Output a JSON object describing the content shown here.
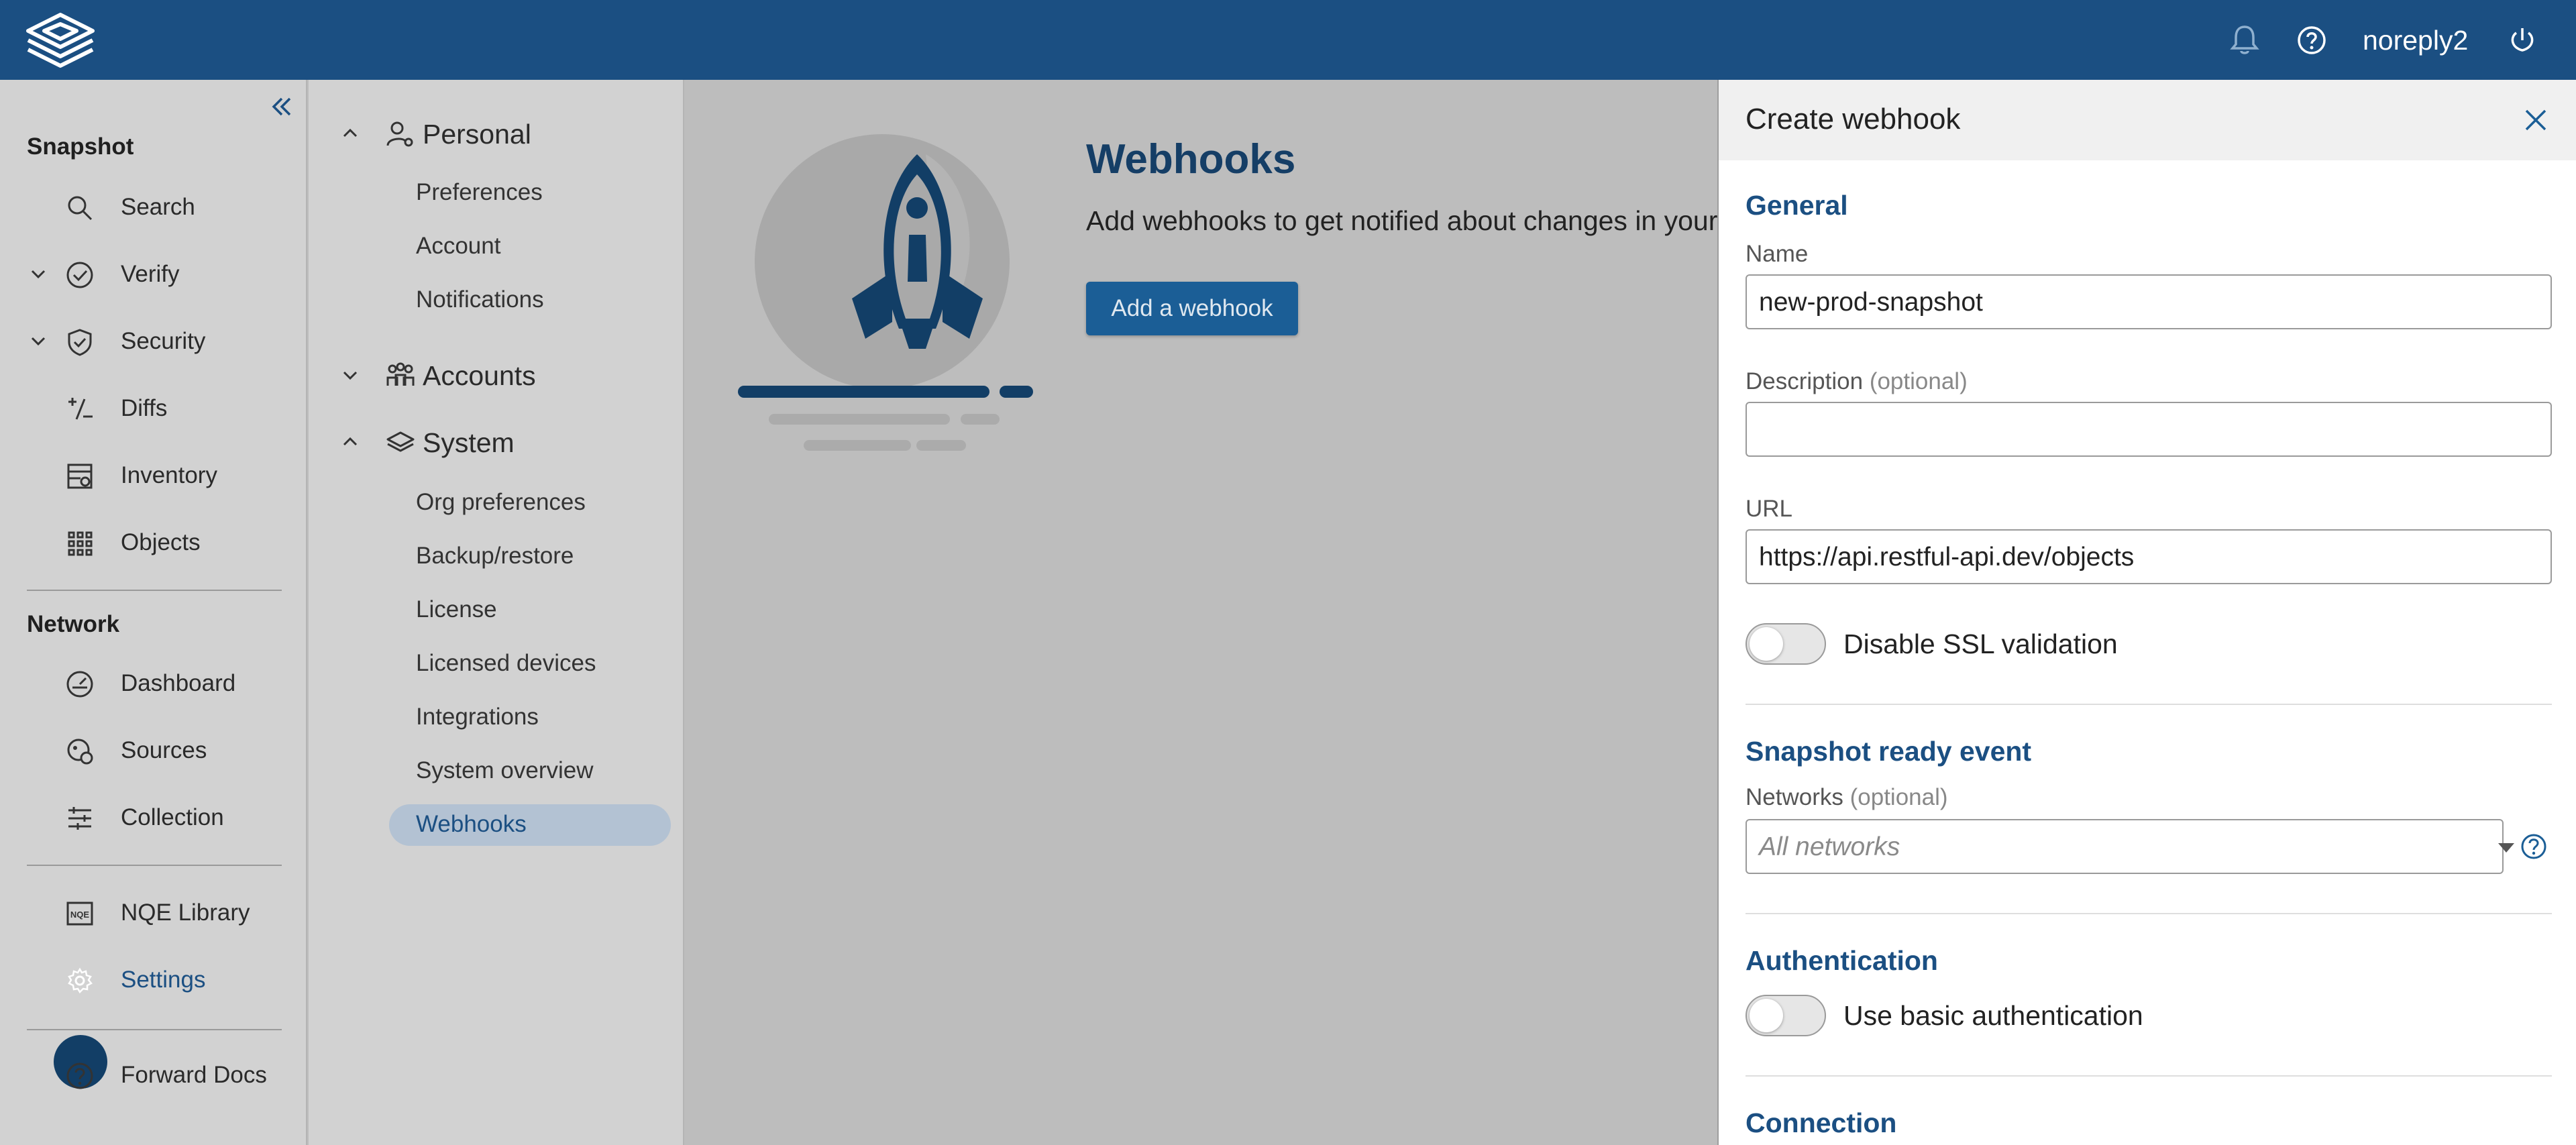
{
  "topbar": {
    "user": "noreply2"
  },
  "leftnav": {
    "sections": [
      {
        "heading": "Snapshot"
      },
      {
        "heading": "Network"
      }
    ],
    "snapshot_items": [
      {
        "label": "Search",
        "icon": "search-icon"
      },
      {
        "label": "Verify",
        "icon": "check-circle-icon"
      },
      {
        "label": "Security",
        "icon": "shield-check-icon"
      },
      {
        "label": "Diffs",
        "icon": "plus-minus-icon"
      },
      {
        "label": "Inventory",
        "icon": "inventory-icon"
      },
      {
        "label": "Objects",
        "icon": "grid-icon"
      }
    ],
    "network_items": [
      {
        "label": "Dashboard",
        "icon": "gauge-icon"
      },
      {
        "label": "Sources",
        "icon": "sources-icon"
      },
      {
        "label": "Collection",
        "icon": "sliders-icon"
      }
    ],
    "other_items": [
      {
        "label": "NQE Library",
        "icon": "nqe-icon"
      },
      {
        "label": "Settings",
        "icon": "gear-icon",
        "active": true
      },
      {
        "label": "Forward Docs",
        "icon": "help-circle-icon"
      }
    ]
  },
  "subnav": {
    "groups": [
      {
        "label": "Personal",
        "items": [
          "Preferences",
          "Account",
          "Notifications"
        ]
      },
      {
        "label": "Accounts",
        "items": []
      },
      {
        "label": "System",
        "items": [
          "Org preferences",
          "Backup/restore",
          "License",
          "Licensed devices",
          "Integrations",
          "System overview",
          "Webhooks"
        ]
      }
    ],
    "active_item": "Webhooks"
  },
  "main": {
    "title": "Webhooks",
    "description": "Add webhooks to get notified about changes in your network.",
    "add_button": "Add a webhook"
  },
  "drawer": {
    "title": "Create webhook",
    "general": {
      "heading": "General",
      "name_label": "Name",
      "name_value": "new-prod-snapshot",
      "description_label": "Description",
      "optional": "(optional)",
      "description_value": "",
      "url_label": "URL",
      "url_value": "https://api.restful-api.dev/objects",
      "ssl_toggle_label": "Disable SSL validation",
      "ssl_toggle_on": false
    },
    "snapshot_event": {
      "heading": "Snapshot ready event",
      "networks_label": "Networks",
      "optional": "(optional)",
      "networks_placeholder": "All networks"
    },
    "auth": {
      "heading": "Authentication",
      "toggle_label": "Use basic authentication",
      "toggle_on": false
    },
    "connection": {
      "heading": "Connection"
    }
  },
  "colors": {
    "topbar": "#1b4f82",
    "accent": "#1b4f82",
    "button": "#1b5e96",
    "active_nav_bg": "#123e66"
  }
}
